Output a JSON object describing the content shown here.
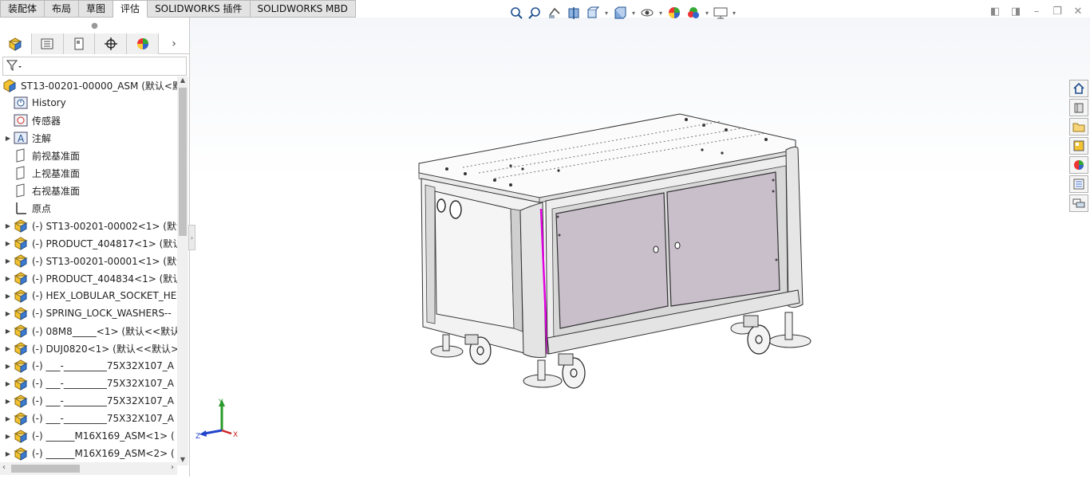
{
  "tabs": [
    "装配体",
    "布局",
    "草图",
    "评估",
    "SOLIDWORKS 插件",
    "SOLIDWORKS MBD"
  ],
  "active_tab_index": 3,
  "hud_icons": [
    "zoom-to-fit-icon",
    "zoom-to-area-icon",
    "previous-view-icon",
    "section-view-icon",
    "view-orientation-icon",
    "display-style-icon",
    "hide-show-items-icon",
    "edit-appearance-icon",
    "apply-scene-icon",
    "view-settings-icon"
  ],
  "feature_manager": {
    "filter_icon": "filter-icon",
    "root": "ST13-00201-00000_ASM  (默认<默认",
    "items": [
      {
        "label": "History",
        "icon": "history-icon",
        "expandable": false
      },
      {
        "label": "传感器",
        "icon": "sensor-icon",
        "expandable": false
      },
      {
        "label": "注解",
        "icon": "annotation-icon",
        "expandable": true
      },
      {
        "label": "前视基准面",
        "icon": "plane-icon",
        "expandable": false
      },
      {
        "label": "上视基准面",
        "icon": "plane-icon",
        "expandable": false
      },
      {
        "label": "右视基准面",
        "icon": "plane-icon",
        "expandable": false
      },
      {
        "label": "原点",
        "icon": "origin-icon",
        "expandable": false
      },
      {
        "label": "(-) ST13-00201-00002<1> (默认",
        "icon": "part-icon",
        "expandable": true
      },
      {
        "label": "(-) PRODUCT_404817<1> (默认",
        "icon": "part-icon",
        "expandable": true
      },
      {
        "label": "(-) ST13-00201-00001<1> (默认",
        "icon": "part-icon",
        "expandable": true
      },
      {
        "label": "(-) PRODUCT_404834<1> (默认",
        "icon": "part-icon",
        "expandable": true
      },
      {
        "label": "(-) HEX_LOBULAR_SOCKET_HE",
        "icon": "part-icon",
        "expandable": true
      },
      {
        "label": "(-) SPRING_LOCK_WASHERS--",
        "icon": "part-icon",
        "expandable": true
      },
      {
        "label": "(-) 08M8_____<1> (默认<<默认",
        "icon": "part-icon",
        "expandable": true
      },
      {
        "label": "(-) DUJ0820<1> (默认<<默认>",
        "icon": "part-icon",
        "expandable": true
      },
      {
        "label": "(-) ___-_________75X32X107_A",
        "icon": "part-icon",
        "expandable": true
      },
      {
        "label": "(-) ___-_________75X32X107_A",
        "icon": "part-icon",
        "expandable": true
      },
      {
        "label": "(-) ___-_________75X32X107_A",
        "icon": "part-icon",
        "expandable": true
      },
      {
        "label": "(-) ___-_________75X32X107_A",
        "icon": "part-icon",
        "expandable": true
      },
      {
        "label": "(-) ______M16X169_ASM<1> (",
        "icon": "part-icon",
        "expandable": true
      },
      {
        "label": "(-) ______M16X169_ASM<2> (",
        "icon": "part-icon",
        "expandable": true
      }
    ]
  },
  "triad": {
    "x": "X",
    "y": "Y",
    "z": "Z"
  },
  "task_pane_icons": [
    "home-icon",
    "design-library-icon",
    "file-explorer-icon",
    "view-palette-icon",
    "appearances-icon",
    "custom-properties-icon",
    "forum-icon"
  ],
  "colors": {
    "accent": "#1f6fd0",
    "door_panel": "#c9bfcb",
    "highlight_edge": "#e000e0",
    "part_yellow": "#f2c230"
  }
}
